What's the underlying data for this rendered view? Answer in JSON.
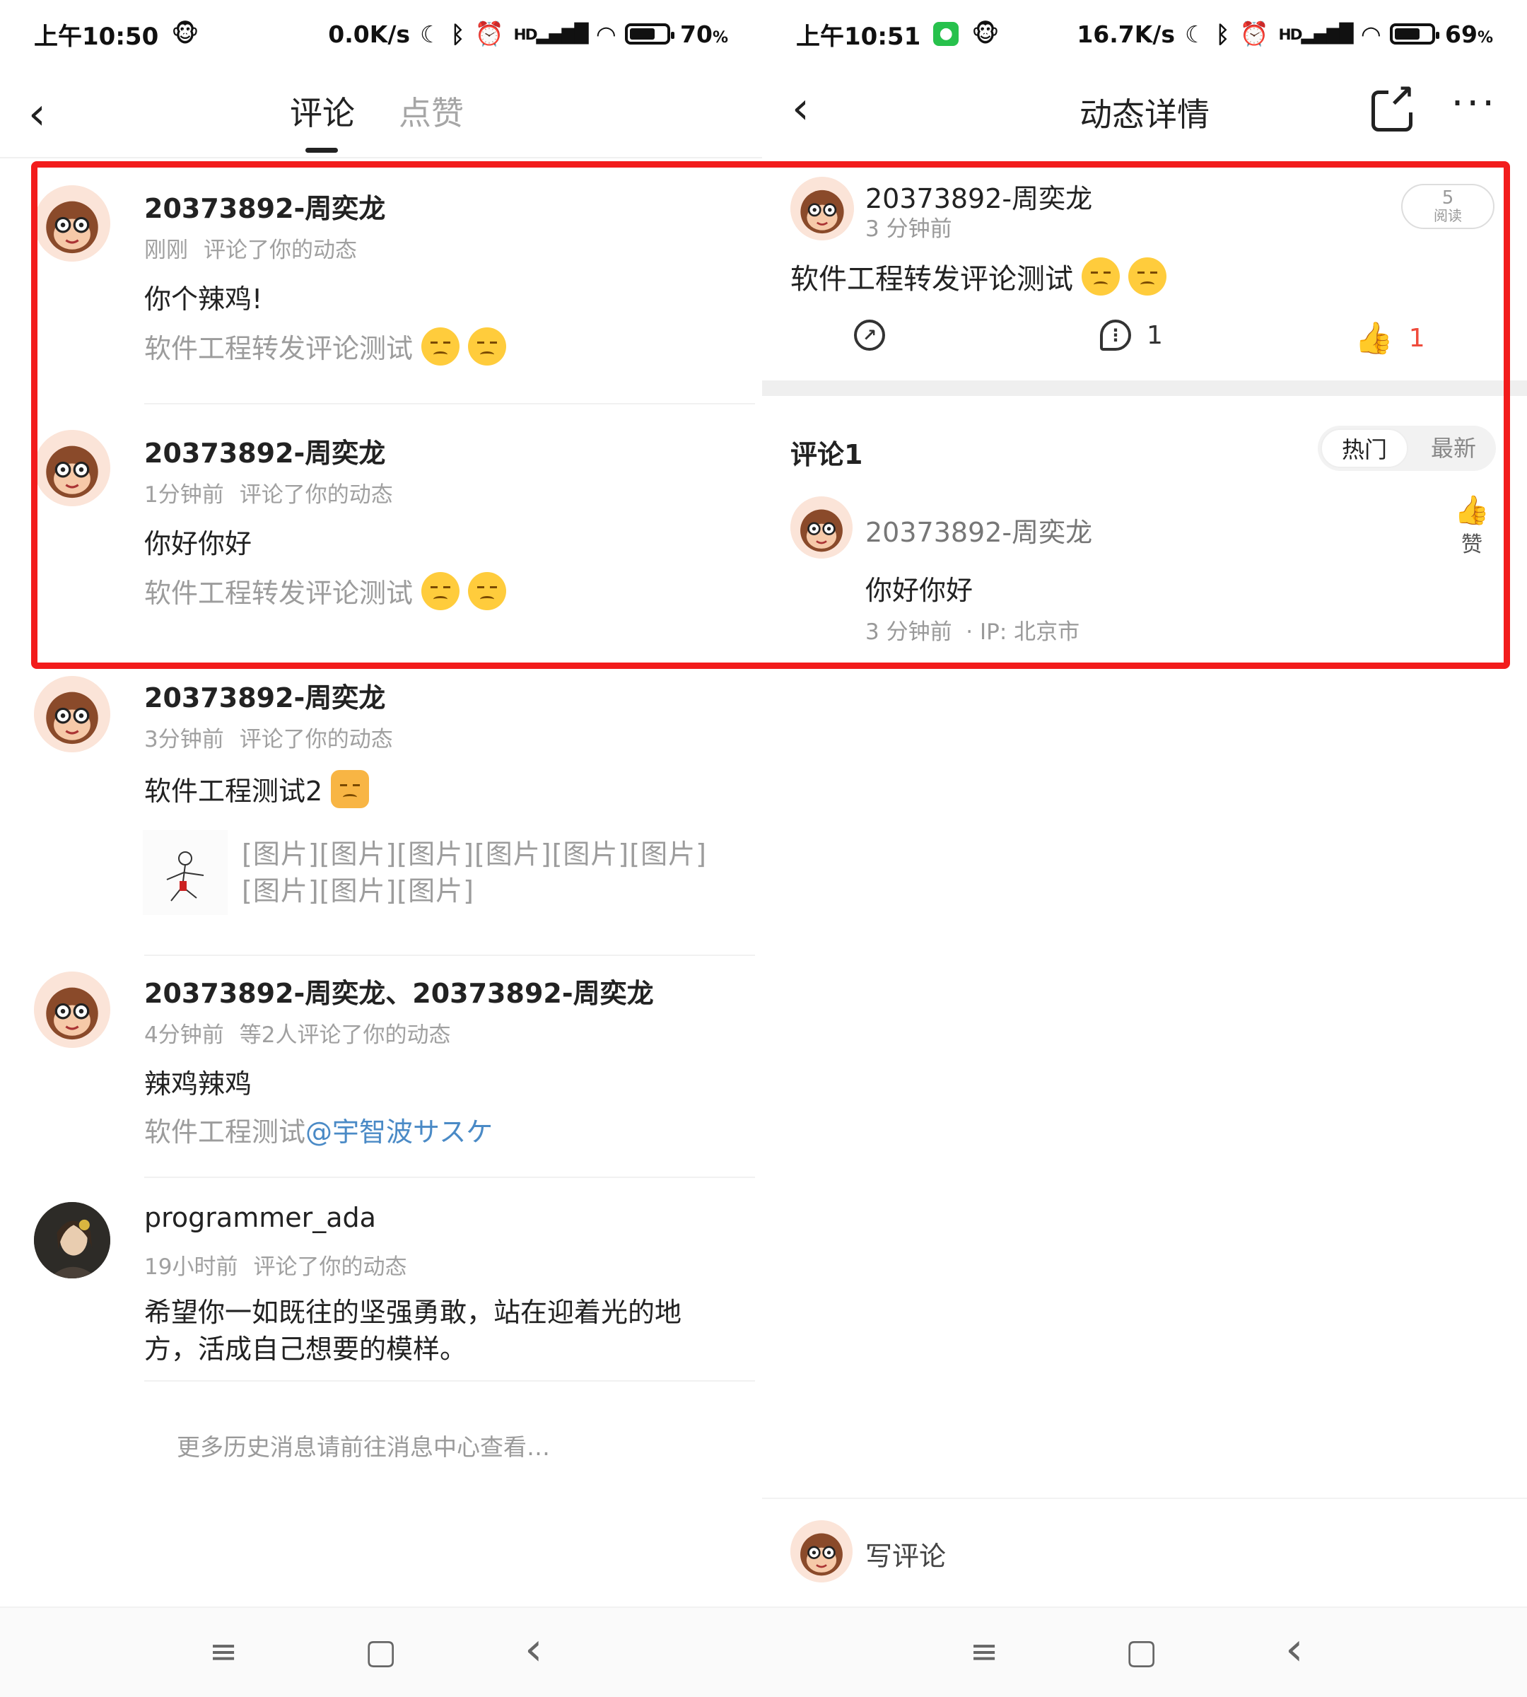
{
  "left": {
    "status": {
      "time": "上午10:50",
      "speed": "0.0K/s",
      "battery_pct": "70",
      "pct_unit": "%",
      "battery_level": 0.7,
      "hd": "HD"
    },
    "tabs": [
      "评论",
      "点赞"
    ],
    "items": [
      {
        "user": "20373892-周奕龙",
        "time": "刚刚",
        "action": "评论了你的动态",
        "comment": "你个辣鸡!",
        "quote": "软件工程转发评论测试"
      },
      {
        "user": "20373892-周奕龙",
        "time": "1分钟前",
        "action": "评论了你的动态",
        "comment": "你好你好",
        "quote": "软件工程转发评论测试"
      },
      {
        "user": "20373892-周奕龙",
        "time": "3分钟前",
        "action": "评论了你的动态",
        "comment": "软件工程测试2",
        "images_line1": "[图片][图片][图片][图片][图片][图片]",
        "images_line2": "[图片][图片][图片]"
      },
      {
        "user": "20373892-周奕龙、20373892-周奕龙",
        "time": "4分钟前",
        "action": "等2人评论了你的动态",
        "comment": "辣鸡辣鸡",
        "quote": "软件工程测试",
        "mention": "@宇智波サスケ"
      },
      {
        "user": "programmer_ada",
        "time": "19小时前",
        "action": "评论了你的动态",
        "comment_line1": "希望你一如既往的坚强勇敢，站在迎着光的地",
        "comment_line2": "方，活成自己想要的模样。"
      }
    ],
    "more": "更多历史消息请前往消息中心查看…"
  },
  "right": {
    "status": {
      "time": "上午10:51",
      "speed": "16.7K/s",
      "battery_pct": "69",
      "pct_unit": "%",
      "battery_level": 0.69,
      "hd": "HD"
    },
    "title": "动态详情",
    "post": {
      "user": "20373892-周奕龙",
      "time": "3 分钟前",
      "reads": "5",
      "reads_label": "阅读",
      "text": "软件工程转发评论测试",
      "comments": "1",
      "likes": "1"
    },
    "comments_header": "评论1",
    "sort": {
      "hot": "热门",
      "new": "最新"
    },
    "comment": {
      "user": "20373892-周奕龙",
      "text": "你好你好",
      "time": "3 分钟前",
      "ip": "· IP: 北京市",
      "like_label": "赞"
    },
    "write": "写评论"
  },
  "nav": {
    "menu": "≡",
    "home": "▢",
    "back": "‹"
  },
  "colors": {
    "highlight": "#f21c1c",
    "like": "#ef4b3c",
    "link": "#4a8ac6"
  }
}
